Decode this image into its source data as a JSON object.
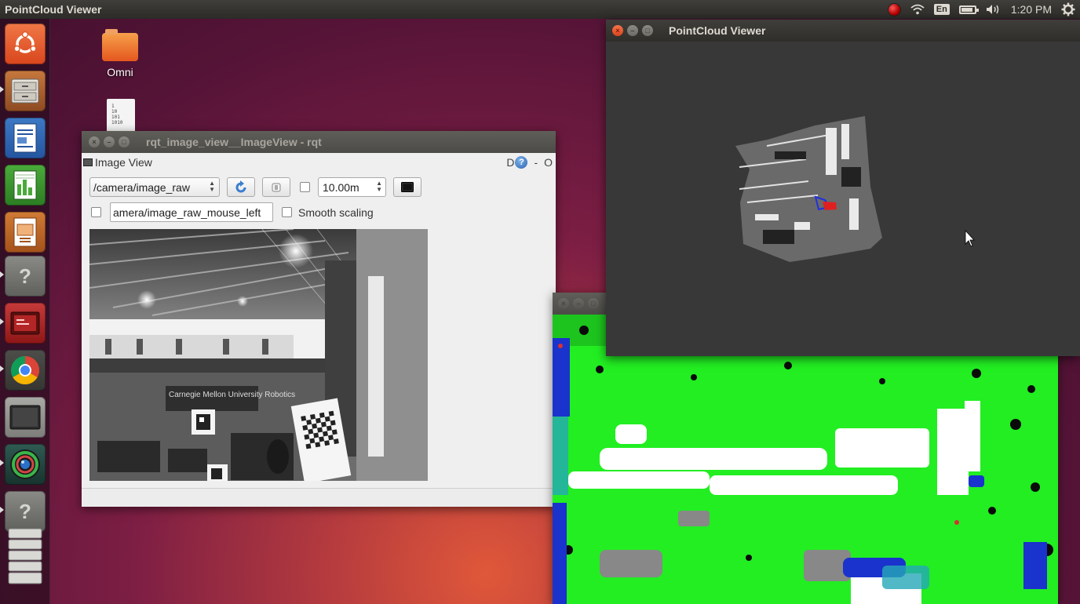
{
  "top_panel": {
    "app_title": "PointCloud Viewer",
    "keyboard_layout": "En",
    "clock": "1:20 PM",
    "indicators": [
      "record-icon",
      "wifi-icon",
      "keyboard-icon",
      "battery-icon",
      "volume-icon",
      "power-gear-icon"
    ]
  },
  "launcher": {
    "items": [
      {
        "name": "ubuntu-dash",
        "icon": "ubuntu-logo-icon"
      },
      {
        "name": "files",
        "icon": "file-cabinet-icon"
      },
      {
        "name": "writer",
        "icon": "writer-document-icon"
      },
      {
        "name": "calc",
        "icon": "calc-spreadsheet-icon"
      },
      {
        "name": "impress",
        "icon": "impress-presentation-icon"
      },
      {
        "name": "unknown-app-1",
        "icon": "question-mark-icon"
      },
      {
        "name": "terminal-red",
        "icon": "red-terminal-icon"
      },
      {
        "name": "chrome",
        "icon": "chrome-icon"
      },
      {
        "name": "display",
        "icon": "monitor-icon"
      },
      {
        "name": "camera-app",
        "icon": "lens-icon"
      },
      {
        "name": "unknown-app-2",
        "icon": "question-mark-icon"
      },
      {
        "name": "workspaces",
        "icon": "stack-icon"
      }
    ]
  },
  "desktop": {
    "icons": [
      {
        "label": "Omni",
        "icon": "folder-icon"
      },
      {
        "label": "",
        "icon": "binary-file-icon",
        "glyph": "1\n10\n101\n1010"
      }
    ]
  },
  "rqt_window": {
    "title": "rqt_image_view__ImageView - rqt",
    "plugin_title": "Image View",
    "plugin_controls": {
      "d_label": "D",
      "help": "?",
      "minus": "-",
      "o_label": "O"
    },
    "topic_value": "/camera/image_raw",
    "refresh_icon": "refresh-icon",
    "zoom_icon": "zoom-fit-icon",
    "dynamic_range_checked": false,
    "max_depth_value": "10.00m",
    "save_icon": "save-image-icon",
    "mouse_publish_checked": false,
    "mouse_topic_value": "amera/image_raw_mouse_left",
    "smooth_scaling_checked": false,
    "smooth_scaling_label": "Smooth scaling",
    "image_overlay_text": "Carnegie Mellon University Robotics"
  },
  "pointcloud_window": {
    "title": "PointCloud Viewer"
  },
  "depth_window": {
    "title": "",
    "colors": {
      "primary": "#22ee22",
      "secondary": "#ffffff",
      "accent": "#1a33cc"
    }
  },
  "colors": {
    "desktop_bg": "#7d1e44",
    "panel_bg": "#2c2b28",
    "close_button": "#e8562a"
  }
}
